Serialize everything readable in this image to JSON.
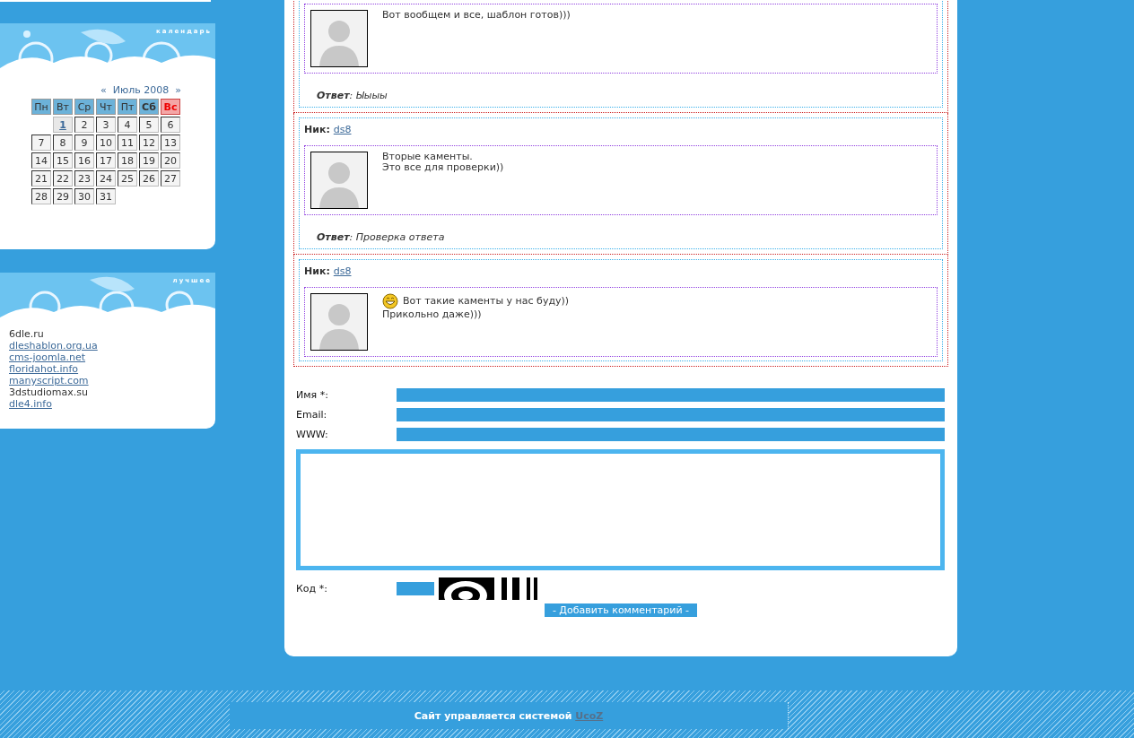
{
  "sidebar": {
    "calendar": {
      "title": "календарь",
      "prev": "«",
      "month": "Июль 2008",
      "next": "»",
      "weekdays": [
        {
          "label": "Пн",
          "kind": "weekday"
        },
        {
          "label": "Вт",
          "kind": "weekday"
        },
        {
          "label": "Ср",
          "kind": "weekday"
        },
        {
          "label": "Чт",
          "kind": "weekday"
        },
        {
          "label": "Пт",
          "kind": "weekday"
        },
        {
          "label": "Сб",
          "kind": "saturday"
        },
        {
          "label": "Вс",
          "kind": "sunday"
        }
      ],
      "weeks": [
        [
          {
            "kind": "blank"
          },
          {
            "day": "1",
            "kind": "link"
          },
          {
            "day": "2",
            "kind": "day"
          },
          {
            "day": "3",
            "kind": "day"
          },
          {
            "day": "4",
            "kind": "day"
          },
          {
            "day": "5",
            "kind": "day"
          },
          {
            "day": "6",
            "kind": "day"
          }
        ],
        [
          {
            "day": "7",
            "kind": "day"
          },
          {
            "day": "8",
            "kind": "day"
          },
          {
            "day": "9",
            "kind": "day"
          },
          {
            "day": "10",
            "kind": "day"
          },
          {
            "day": "11",
            "kind": "day"
          },
          {
            "day": "12",
            "kind": "day"
          },
          {
            "day": "13",
            "kind": "day"
          }
        ],
        [
          {
            "day": "14",
            "kind": "day"
          },
          {
            "day": "15",
            "kind": "day"
          },
          {
            "day": "16",
            "kind": "day"
          },
          {
            "day": "17",
            "kind": "day"
          },
          {
            "day": "18",
            "kind": "day"
          },
          {
            "day": "19",
            "kind": "day"
          },
          {
            "day": "20",
            "kind": "day"
          }
        ],
        [
          {
            "day": "21",
            "kind": "day"
          },
          {
            "day": "22",
            "kind": "day"
          },
          {
            "day": "23",
            "kind": "day"
          },
          {
            "day": "24",
            "kind": "day"
          },
          {
            "day": "25",
            "kind": "day"
          },
          {
            "day": "26",
            "kind": "day"
          },
          {
            "day": "27",
            "kind": "day"
          }
        ],
        [
          {
            "day": "28",
            "kind": "day"
          },
          {
            "day": "29",
            "kind": "day"
          },
          {
            "day": "30",
            "kind": "day"
          },
          {
            "day": "31",
            "kind": "day"
          }
        ]
      ]
    },
    "best": {
      "title": "лучшее",
      "links": [
        {
          "label": "6dle.ru",
          "link": false
        },
        {
          "label": "dleshablon.org.ua",
          "link": true
        },
        {
          "label": "cms-joomla.net",
          "link": true
        },
        {
          "label": "floridahot.info",
          "link": true
        },
        {
          "label": "manyscript.com",
          "link": true
        },
        {
          "label": "3dstudiomax.su",
          "link": false
        },
        {
          "label": "dle4.info",
          "link": true
        }
      ]
    }
  },
  "comments": [
    {
      "lines": [
        "Вот вообщем и все, шаблон готов)))"
      ],
      "smiley": false,
      "reply": "**Ответ**: Ыыыы"
    },
    {
      "nick_label": "Ник:",
      "nick": "ds8",
      "lines": [
        "Вторые каменты.",
        "Это все для проверки))"
      ],
      "smiley": false,
      "reply": "**Ответ**: Проверка ответа"
    },
    {
      "nick_label": "Ник:",
      "nick": "ds8",
      "lines": [
        "Вот такие каменты у нас буду))",
        "Прикольно даже)))"
      ],
      "smiley": true
    }
  ],
  "form": {
    "fields": [
      {
        "label": "Имя *:"
      },
      {
        "label": "Email:"
      },
      {
        "label": "WWW:"
      }
    ],
    "code_label": "Код *:",
    "submit": "- Добавить комментарий -"
  },
  "footer": {
    "text": "Сайт управляется системой",
    "link": "UcoZ"
  }
}
